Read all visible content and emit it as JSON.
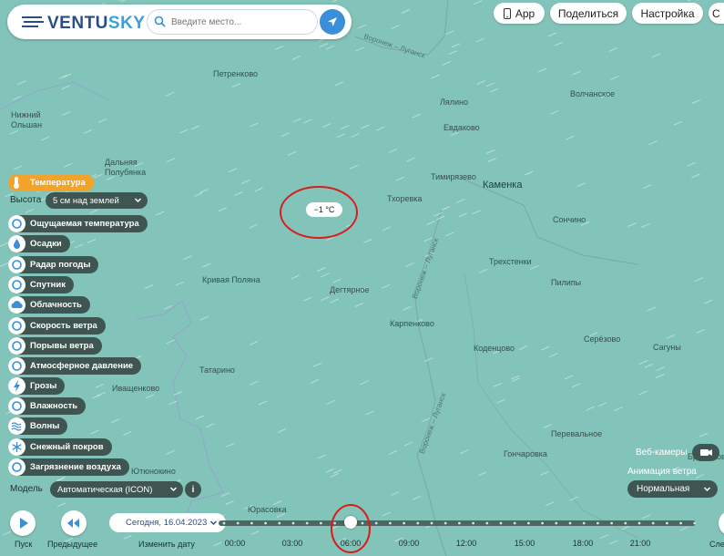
{
  "app": {
    "logo_prefix": "VENTU",
    "logo_suffix": "SKY",
    "brand_color": "#2a4d88",
    "accent_color": "#3aa0dd"
  },
  "search": {
    "placeholder": "Введите место...",
    "value": ""
  },
  "top_buttons": {
    "app": "App",
    "share": "Поделиться",
    "settings": "Настройка",
    "more": "С"
  },
  "layers": {
    "active_color": "#f3a22a",
    "items": [
      {
        "label": "Температура",
        "icon": "thermometer-icon",
        "active": true
      },
      {
        "label": "Ощущаемая температура",
        "icon": "feels-like-icon",
        "active": false
      },
      {
        "label": "Осадки",
        "icon": "raindrop-icon",
        "active": false
      },
      {
        "label": "Радар погоды",
        "icon": "radar-icon",
        "active": false
      },
      {
        "label": "Спутник",
        "icon": "satellite-icon",
        "active": false
      },
      {
        "label": "Облачность",
        "icon": "cloud-icon",
        "active": false
      },
      {
        "label": "Скорость ветра",
        "icon": "wind-icon",
        "active": false
      },
      {
        "label": "Порывы ветра",
        "icon": "gust-icon",
        "active": false
      },
      {
        "label": "Атмосферное давление",
        "icon": "pressure-icon",
        "active": false
      },
      {
        "label": "Грозы",
        "icon": "lightning-icon",
        "active": false
      },
      {
        "label": "Влажность",
        "icon": "humidity-icon",
        "active": false
      },
      {
        "label": "Волны",
        "icon": "waves-icon",
        "active": false
      },
      {
        "label": "Снежный покров",
        "icon": "snowflake-icon",
        "active": false
      },
      {
        "label": "Загрязнение воздуха",
        "icon": "pollution-icon",
        "active": false
      }
    ]
  },
  "height": {
    "label": "Высота",
    "value": "5 см над землей"
  },
  "model": {
    "label": "Модель",
    "value": "Автоматическая (ICON)",
    "info": "i"
  },
  "map": {
    "temperature_tooltip": "−1 °C",
    "places": [
      "Петренково",
      "Нижний Ольшан",
      "Дальняя Полубянка",
      "Лялино",
      "Евдаково",
      "Волчанское",
      "Тимирязево",
      "Тхоревка",
      "Каменка",
      "Сончино",
      "Трехстенки",
      "Пилипы",
      "Кривая Поляна",
      "Дегтярное",
      "Карпенково",
      "Коденцово",
      "Серёзово",
      "Сагуны",
      "Татарино",
      "Иващенково",
      "Юрасовка",
      "Гончаровка",
      "Перевальное",
      "Ютюнокино",
      "Брилюково"
    ],
    "road_labels": [
      "Воронеж – Луганск",
      "Воронеж – Луганск",
      "Воронеж – Луганск"
    ]
  },
  "right_panel": {
    "webcams_label": "Веб-камеры",
    "animation_label": "Анимация ветра",
    "animation_value": "Нормальная"
  },
  "timeline": {
    "play_label": "Пуск",
    "prev_label": "Предыдущее",
    "change_date_label": "Изменить дату",
    "next_label": "След",
    "date_value": "Сегодня, 16.04.2023",
    "hours": [
      "00:00",
      "03:00",
      "06:00",
      "09:00",
      "12:00",
      "15:00",
      "18:00",
      "21:00"
    ],
    "selected_hour": "06:00"
  }
}
